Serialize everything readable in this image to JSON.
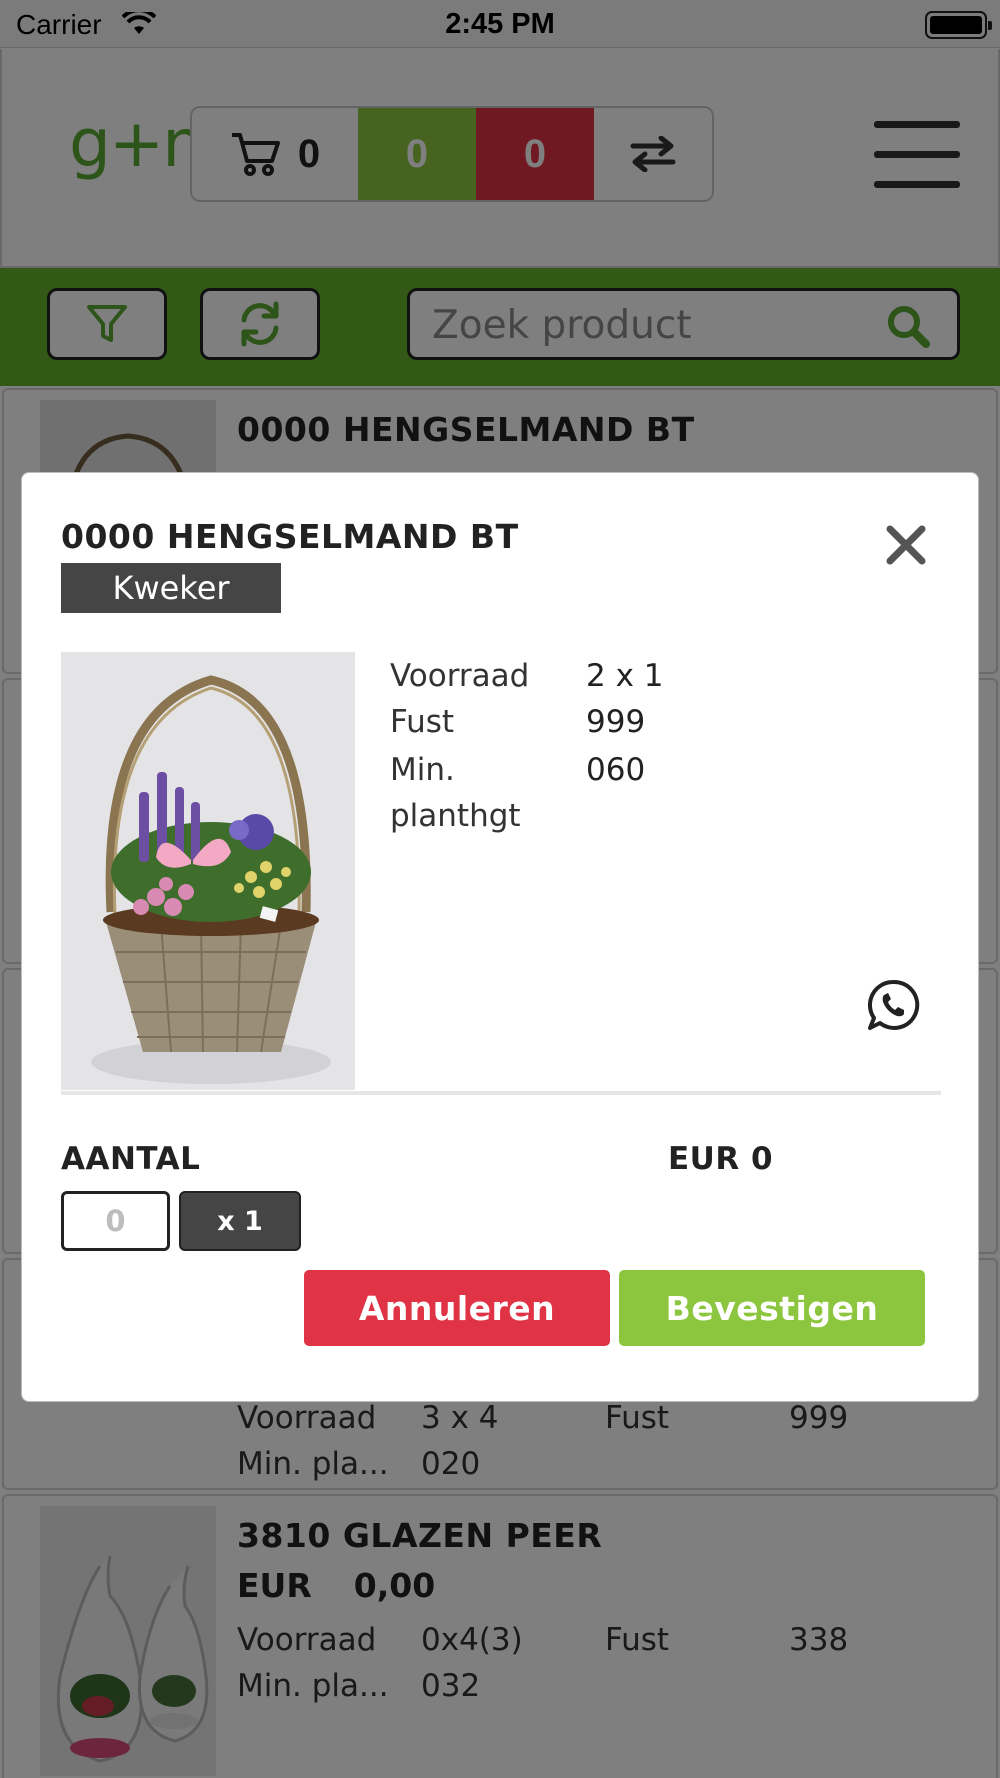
{
  "status_bar": {
    "carrier": "Carrier",
    "time": "2:45 PM"
  },
  "header": {
    "logo_text": "g+m",
    "cart_count": "0",
    "green_count": "0",
    "red_count": "0",
    "icons": [
      "cart-icon",
      "swap-arrows-icon",
      "hamburger-menu-icon"
    ]
  },
  "toolbar": {
    "search_placeholder": "Zoek product",
    "icons": [
      "filter-icon",
      "refresh-icon",
      "search-icon"
    ]
  },
  "list": {
    "items": [
      {
        "title": "0000 HENGSELMAND BT"
      },
      {
        "voorraad_label": "Voorraad",
        "voorraad": "3 x 4",
        "fust_label": "Fust",
        "fust": "999",
        "min_label": "Min. pla...",
        "min": "020"
      },
      {
        "title": "3810 GLAZEN PEER",
        "currency": "EUR",
        "price": "0,00",
        "voorraad_label": "Voorraad",
        "voorraad": "0x4(3)",
        "fust_label": "Fust",
        "fust": "338",
        "min_label": "Min. pla...",
        "min": "032"
      }
    ]
  },
  "modal": {
    "title": "0000 HENGSELMAND BT",
    "badge": "Kweker",
    "specs": {
      "voorraad_label": "Voorraad",
      "voorraad": "2 x 1",
      "fust_label": "Fust",
      "fust": "999",
      "min_label_line1": "Min.",
      "min_label_line2": "planthgt",
      "min": "060"
    },
    "aantal_label": "AANTAL",
    "total": "EUR 0",
    "qty_placeholder": "0",
    "multiplier": "x 1",
    "cancel_label": "Annuleren",
    "confirm_label": "Bevestigen",
    "icons": [
      "close-icon",
      "whatsapp-icon"
    ]
  },
  "colors": {
    "brand_green": "#66b22e",
    "light_green": "#8cc63f",
    "red": "#e03345",
    "dark_gray": "#454545"
  }
}
